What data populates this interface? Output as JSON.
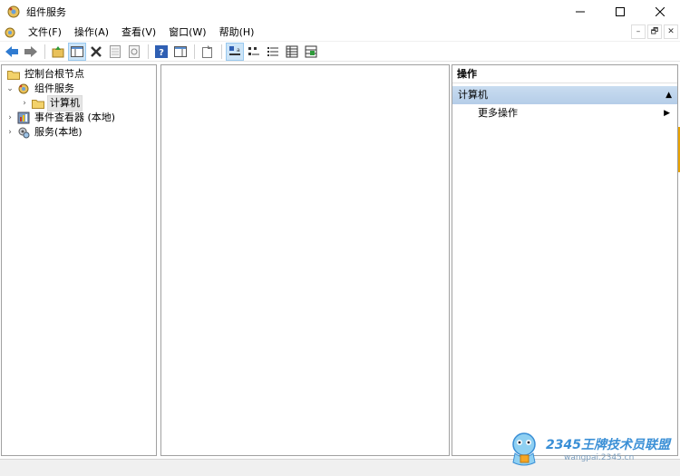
{
  "window": {
    "title": "组件服务",
    "icons": {
      "app": "component-services-icon",
      "minimize": "minimize-icon",
      "maximize": "maximize-icon",
      "close": "close-icon"
    }
  },
  "menu": {
    "items": [
      {
        "label": "文件(F)"
      },
      {
        "label": "操作(A)"
      },
      {
        "label": "查看(V)"
      },
      {
        "label": "窗口(W)"
      },
      {
        "label": "帮助(H)"
      }
    ],
    "mdi": {
      "minimize": "–",
      "restore": "🗗",
      "close": "✕"
    }
  },
  "toolbar": {
    "buttons": [
      "back-arrow-icon",
      "forward-arrow-icon",
      "up-folder-icon",
      "show-hide-tree-icon",
      "delete-icon",
      "properties-icon",
      "refresh-icon",
      "help-icon",
      "show-hide-action-pane-icon",
      "export-list-icon",
      "large-icons-icon",
      "small-icons-icon",
      "list-view-icon",
      "detail-view-icon",
      "configure-icon"
    ],
    "active": "large-icons-icon"
  },
  "tree": {
    "items": [
      {
        "label": "控制台根节点",
        "icon": "folder-icon"
      },
      {
        "label": "组件服务",
        "icon": "component-services-icon",
        "expander": "⌄"
      },
      {
        "label": "计算机",
        "icon": "folder-icon",
        "expander": "›",
        "selected": true
      },
      {
        "label": "事件查看器 (本地)",
        "icon": "event-viewer-icon",
        "expander": "›"
      },
      {
        "label": "服务(本地)",
        "icon": "services-icon",
        "expander": "›"
      }
    ]
  },
  "actions": {
    "header": "操作",
    "section": {
      "label": "计算机",
      "collapse": "▲"
    },
    "items": [
      {
        "label": "更多操作",
        "arrow": "▶"
      }
    ]
  },
  "watermark": {
    "brand": "2345王牌技术员联盟",
    "url": "wangpai.2345.cn"
  },
  "colors": {
    "section_header": "#b5cde8",
    "selection": "#e5e5e5",
    "accent_blue": "#3a8fd6"
  }
}
